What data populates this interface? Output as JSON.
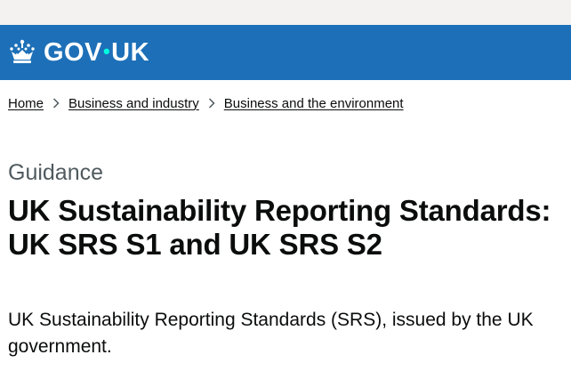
{
  "header": {
    "logo_text_left": "GOV",
    "logo_dot": "•",
    "logo_text_right": "UK",
    "logo_icon": "crown-icon",
    "brand_color": "#1d70b8",
    "dot_color": "#00ffe0"
  },
  "breadcrumbs": [
    {
      "label": "Home"
    },
    {
      "label": "Business and industry"
    },
    {
      "label": "Business and the environment"
    }
  ],
  "main": {
    "caption": "Guidance",
    "title": "UK Sustainability Reporting Standards: UK SRS S1 and UK SRS S2",
    "summary": "UK Sustainability Reporting Standards (SRS), issued by the UK government."
  }
}
